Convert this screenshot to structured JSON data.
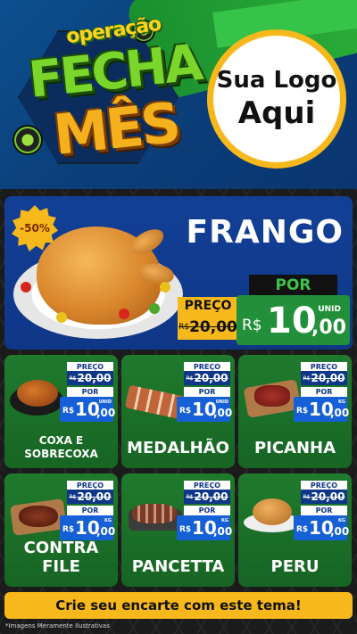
{
  "header": {
    "brand_top": "operação",
    "brand_mid": "FECHA",
    "brand_bottom": "MÊS",
    "logo_line1": "Sua Logo",
    "logo_line2": "Aqui"
  },
  "featured": {
    "badge": "-50%",
    "name": "FRANGO",
    "preco_label": "PREÇO",
    "old_currency": "R$",
    "old_value": "20,00",
    "por_label": "POR",
    "new_currency": "R$",
    "new_value": "10",
    "new_cents": ",00",
    "unit": "UNID"
  },
  "products": [
    {
      "name": "COXA E SOBRECOXA",
      "preco_label": "PREÇO",
      "old_currency": "R$",
      "old_value": "20,00",
      "por_label": "POR",
      "new_currency": "R$",
      "new_value": "10",
      "new_cents": ",00",
      "unit": "UNID"
    },
    {
      "name": "MEDALHÃO",
      "preco_label": "PREÇO",
      "old_currency": "R$",
      "old_value": "20,00",
      "por_label": "POR",
      "new_currency": "R$",
      "new_value": "10",
      "new_cents": ",00",
      "unit": "UNID"
    },
    {
      "name": "PICANHA",
      "preco_label": "PREÇO",
      "old_currency": "R$",
      "old_value": "20,00",
      "por_label": "POR",
      "new_currency": "R$",
      "new_value": "10",
      "new_cents": ",00",
      "unit": "KG"
    },
    {
      "name": "CONTRA FILE",
      "preco_label": "PREÇO",
      "old_currency": "R$",
      "old_value": "20,00",
      "por_label": "POR",
      "new_currency": "R$",
      "new_value": "10",
      "new_cents": ",00",
      "unit": "KG"
    },
    {
      "name": "PANCETTA",
      "preco_label": "PREÇO",
      "old_currency": "R$",
      "old_value": "20,00",
      "por_label": "POR",
      "new_currency": "R$",
      "new_value": "10",
      "new_cents": ",00",
      "unit": "KG"
    },
    {
      "name": "PERU",
      "preco_label": "PREÇO",
      "old_currency": "R$",
      "old_value": "20,00",
      "por_label": "POR",
      "new_currency": "R$",
      "new_value": "10",
      "new_cents": ",00",
      "unit": "KG"
    }
  ],
  "cta": "Crie seu encarte com este tema!",
  "disclaimer": "*Imagens Meramente Ilustrativas",
  "colors": {
    "header_blue": "#0c4f8f",
    "accent_yellow": "#f6b81b",
    "card_green": "#1f7a2c",
    "price_blue": "#1560d6",
    "featured_blue": "#123f96"
  }
}
